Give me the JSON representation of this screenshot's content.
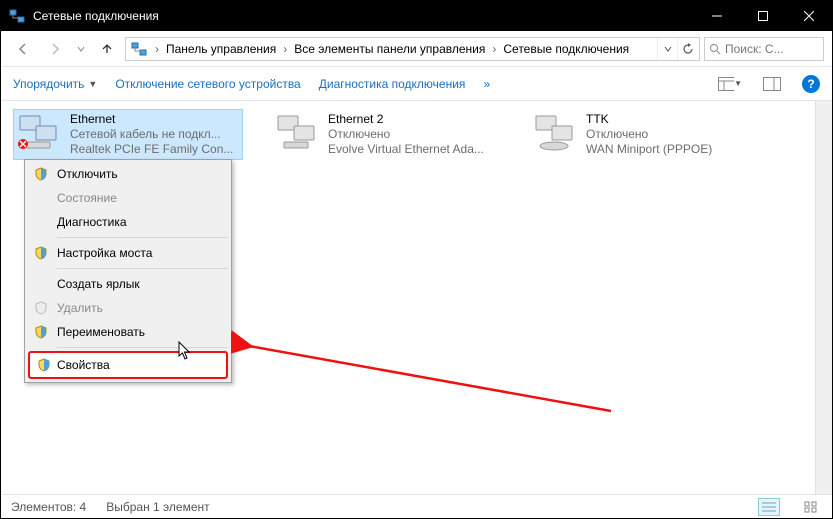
{
  "window": {
    "title": "Сетевые подключения"
  },
  "breadcrumb": {
    "seg1": "Панель управления",
    "seg2": "Все элементы панели управления",
    "seg3": "Сетевые подключения"
  },
  "search": {
    "placeholder": "Поиск: С..."
  },
  "toolbar": {
    "organize": "Упорядочить",
    "disable": "Отключение сетевого устройства",
    "diagnose": "Диагностика подключения",
    "more": "»"
  },
  "connections": [
    {
      "name": "Ethernet",
      "status": "Сетевой кабель не подкл...",
      "device": "Realtek PCIe FE Family Con...",
      "selected": true,
      "error": true
    },
    {
      "name": "Ethernet 2",
      "status": "Отключено",
      "device": "Evolve Virtual Ethernet Ada...",
      "selected": false,
      "error": false
    },
    {
      "name": "TTK",
      "status": "Отключено",
      "device": "WAN Miniport (PPPOE)",
      "selected": false,
      "error": false
    }
  ],
  "context_menu": {
    "disconnect": "Отключить",
    "status": "Состояние",
    "diagnose": "Диагностика",
    "bridge": "Настройка моста",
    "shortcut": "Создать ярлык",
    "delete": "Удалить",
    "rename": "Переименовать",
    "properties": "Свойства"
  },
  "statusbar": {
    "count": "Элементов: 4",
    "selected": "Выбран 1 элемент"
  },
  "colors": {
    "accent": "#0078d7",
    "highlight_border": "#e11",
    "selection": "#cce8ff"
  }
}
